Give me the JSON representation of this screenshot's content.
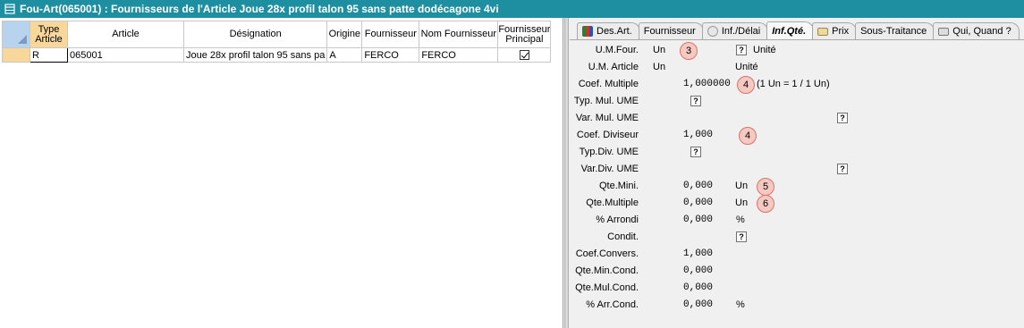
{
  "window": {
    "title": "Fou-Art(065001) : Fournisseurs de l'Article Joue 28x profil talon 95 sans patte dodécagone 4vi"
  },
  "grid": {
    "columns": [
      "Type Article",
      "Article",
      "Désignation",
      "Origine",
      "Fournisseur",
      "Nom Fournisseur",
      "Fournisseur Principal"
    ],
    "rows": [
      {
        "type": "R",
        "article": "065001",
        "designation": "Joue 28x profil talon 95 sans pa",
        "origine": "A",
        "fournisseur": "FERCO",
        "nom": "FERCO",
        "principal": true
      }
    ]
  },
  "tabs": [
    {
      "label": "Des.Art.",
      "icon": "book-icon",
      "active": false
    },
    {
      "label": "Fournisseur",
      "icon": "",
      "active": false
    },
    {
      "label": "Inf./Délai",
      "icon": "clock-icon",
      "active": false
    },
    {
      "label": "Inf.Qté.",
      "icon": "",
      "active": true
    },
    {
      "label": "Prix",
      "icon": "price-icon",
      "active": false
    },
    {
      "label": "Sous-Traitance",
      "icon": "",
      "active": false
    },
    {
      "label": "Qui, Quand ?",
      "icon": "card-icon",
      "active": false
    }
  ],
  "fields": {
    "um_four": {
      "label": "U.M.Four.",
      "value": "Un",
      "badge": "3",
      "unit_text": "Unité"
    },
    "um_article": {
      "label": "U.M. Article",
      "value": "Un",
      "unit_text": "Unité"
    },
    "coef_multiple": {
      "label": "Coef. Multiple",
      "value": "1,000000",
      "badge": "4",
      "note": "(1 Un = 1 / 1 Un)"
    },
    "typ_mul_ume": {
      "label": "Typ. Mul. UME"
    },
    "var_mul_ume": {
      "label": "Var. Mul. UME"
    },
    "coef_diviseur": {
      "label": "Coef. Diviseur",
      "value": "1,000",
      "badge": "4"
    },
    "typ_div_ume": {
      "label": "Typ.Div. UME"
    },
    "var_div_ume": {
      "label": "Var.Div. UME"
    },
    "qte_mini": {
      "label": "Qte.Mini.",
      "value": "0,000",
      "unit": "Un",
      "badge": "5"
    },
    "qte_multiple": {
      "label": "Qte.Multiple",
      "value": "0,000",
      "unit": "Un",
      "badge": "6"
    },
    "pct_arrondi": {
      "label": "% Arrondi",
      "value": "0,000",
      "unit": "%"
    },
    "condit": {
      "label": "Condit."
    },
    "coef_convers": {
      "label": "Coef.Convers.",
      "value": "1,000"
    },
    "qte_min_cond": {
      "label": "Qte.Min.Cond.",
      "value": "0,000"
    },
    "qte_mul_cond": {
      "label": "Qte.Mul.Cond.",
      "value": "0,000"
    },
    "pct_arr_cond": {
      "label": "% Arr.Cond.",
      "value": "0,000",
      "unit": "%"
    }
  },
  "help_button_text": "?",
  "colors": {
    "titlebar": "#1e8fa0",
    "row_highlight": "#f8d79a",
    "badge": "#f6c8c2"
  }
}
